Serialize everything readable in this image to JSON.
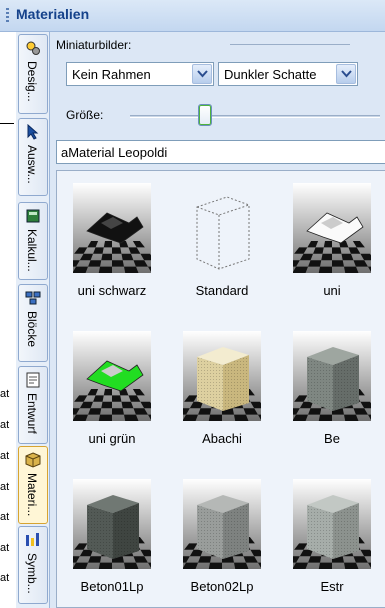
{
  "panel": {
    "title": "Materialien"
  },
  "background_fragments": [
    "at",
    "at",
    "at",
    "at",
    "at",
    "at",
    "at"
  ],
  "tabs": [
    {
      "label": "Desig...",
      "icon": "design-icon",
      "active": false
    },
    {
      "label": "Ausw...",
      "icon": "select-cursor-icon",
      "active": false
    },
    {
      "label": "Kalkul...",
      "icon": "calculator-icon",
      "active": false
    },
    {
      "label": "Blöcke",
      "icon": "blocks-icon",
      "active": false
    },
    {
      "label": "Entwurf",
      "icon": "draft-icon",
      "active": false
    },
    {
      "label": "Materi...",
      "icon": "material-box-icon",
      "active": true
    },
    {
      "label": "Symb...",
      "icon": "symbols-icon",
      "active": false
    }
  ],
  "thumbnails": {
    "label": "Miniaturbilder:",
    "frame_select": {
      "value": "Kein Rahmen"
    },
    "shadow_select": {
      "value": "Dunkler Schatte"
    },
    "size_label": "Größe:",
    "size_value": 0.27
  },
  "selected_material": "aMaterial Leopoldi",
  "materials": [
    {
      "name": "uni schwarz",
      "preview": "letter-black"
    },
    {
      "name": "Standard",
      "preview": "wire-cube"
    },
    {
      "name": "uni",
      "preview": "letter-white"
    },
    {
      "name": "uni grün",
      "preview": "letter-green"
    },
    {
      "name": "Abachi",
      "preview": "cube-wood"
    },
    {
      "name": "Be",
      "preview": "cube-concrete"
    },
    {
      "name": "Beton01Lp",
      "preview": "cube-dark"
    },
    {
      "name": "Beton02Lp",
      "preview": "cube-mid"
    },
    {
      "name": "Estr",
      "preview": "cube-light"
    }
  ],
  "colors": {
    "accent": "#15428b",
    "active_tab": "#fff6d6",
    "green": "#22dd22",
    "wood": "#efe6c4"
  }
}
